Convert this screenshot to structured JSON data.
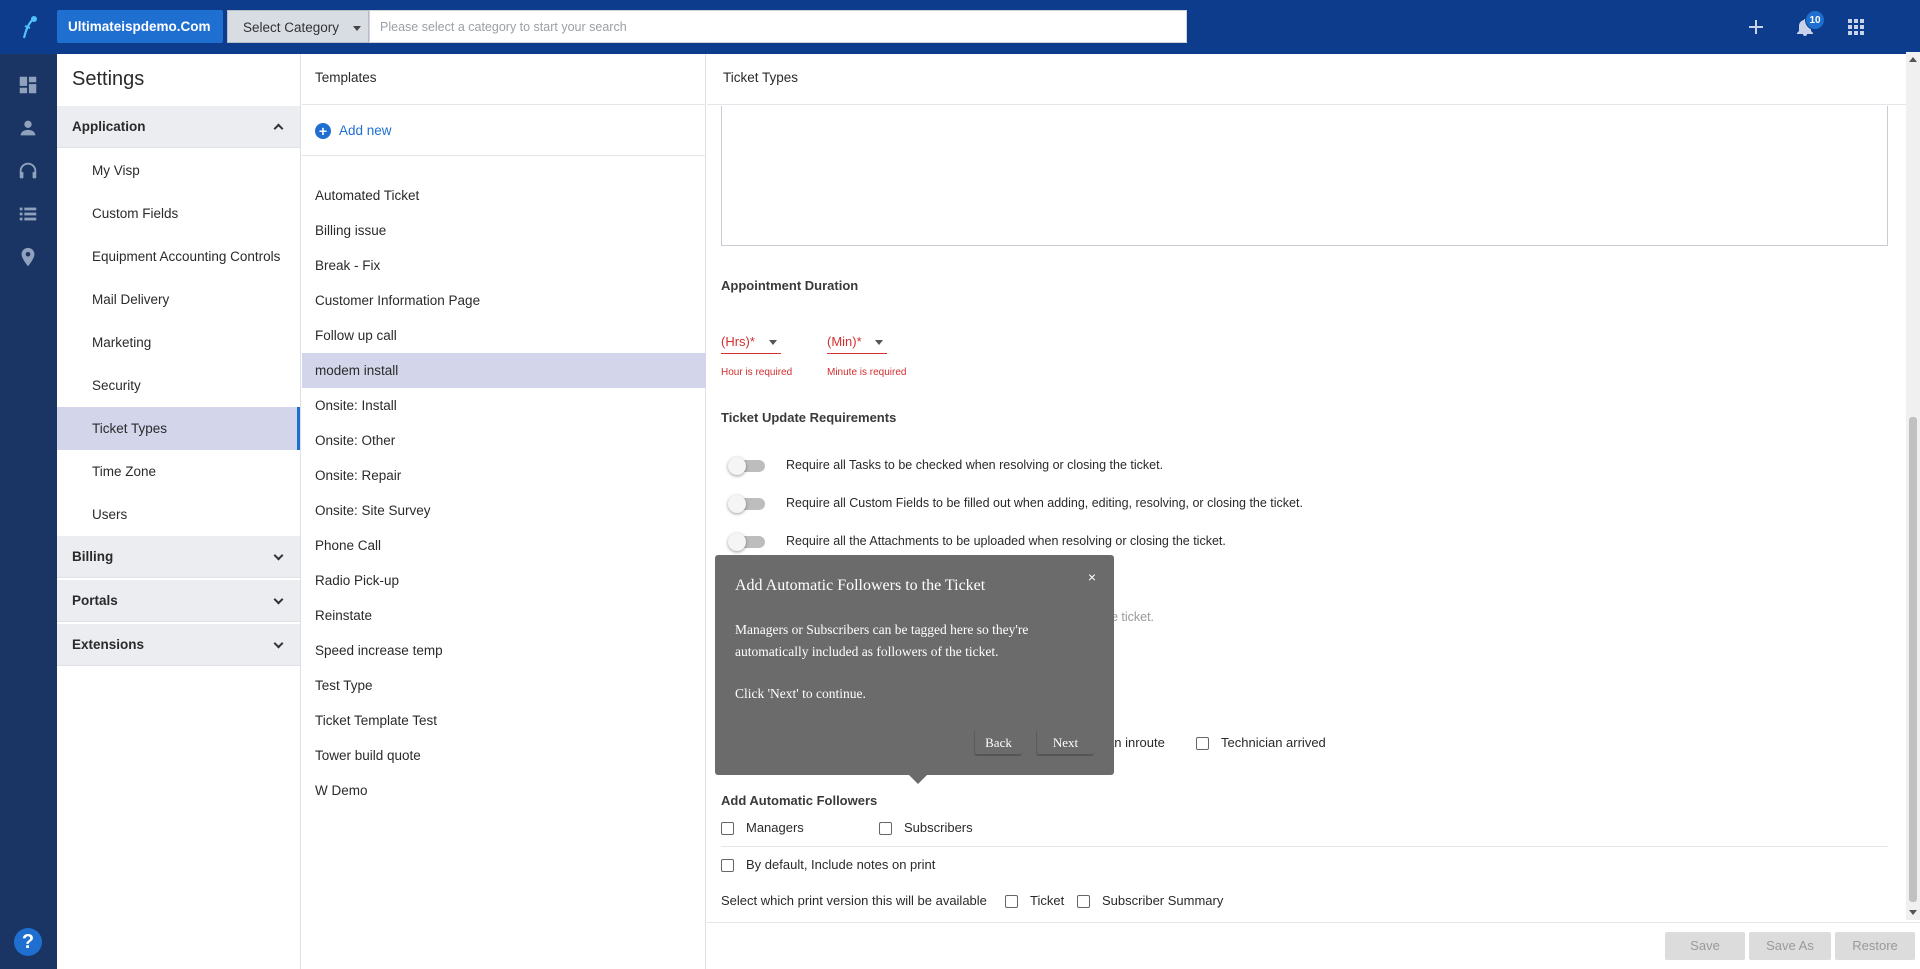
{
  "header": {
    "brand": "Ultimateispdemo.Com",
    "category": "Select Category",
    "search_placeholder": "Please select a category to start your search",
    "notification_count": "10"
  },
  "settings": {
    "title": "Settings",
    "sections": [
      {
        "label": "Application",
        "expanded": true
      },
      {
        "label": "Billing",
        "expanded": false
      },
      {
        "label": "Portals",
        "expanded": false
      },
      {
        "label": "Extensions",
        "expanded": false
      }
    ],
    "application_items": [
      "My Visp",
      "Custom Fields",
      "Equipment Accounting Controls",
      "Mail Delivery",
      "Marketing",
      "Security",
      "Ticket Types",
      "Time Zone",
      "Users"
    ],
    "active_item": "Ticket Types"
  },
  "templates": {
    "title": "Templates",
    "add_new": "Add new",
    "items": [
      "Automated Ticket",
      "Billing issue",
      "Break - Fix",
      "Customer Information Page",
      "Follow up call",
      "modem install",
      "Onsite: Install",
      "Onsite: Other",
      "Onsite: Repair",
      "Onsite: Site Survey",
      "Phone Call",
      "Radio Pick-up",
      "Reinstate",
      "Speed increase temp",
      "Test Type",
      "Ticket Template Test",
      "Tower build quote",
      "W Demo"
    ],
    "active_item": "modem install"
  },
  "ticket_types": {
    "title": "Ticket Types",
    "appointment_duration": {
      "label": "Appointment Duration",
      "hours_placeholder": "(Hrs)*",
      "minutes_placeholder": "(Min)*",
      "hours_error": "Hour is required",
      "minutes_error": "Minute is required"
    },
    "update_requirements": {
      "label": "Ticket Update Requirements",
      "toggles": [
        "Require all Tasks to be checked when resolving or closing the ticket.",
        "Require all Custom Fields to be filled out when adding, editing, resolving, or closing the ticket.",
        "Require all the Attachments to be uploaded when resolving or closing the ticket."
      ],
      "partial_text_1": "he ticket.",
      "partial_text_2": "."
    },
    "status_checks": {
      "partial_label": "an inroute",
      "technician_arrived": "Technician arrived"
    },
    "followers": {
      "label": "Add Automatic Followers",
      "managers": "Managers",
      "subscribers": "Subscribers"
    },
    "include_notes": "By default, Include notes on print",
    "print_version_label": "Select which print version this will be available",
    "print_ticket": "Ticket",
    "print_subscriber_summary": "Subscriber Summary",
    "buttons": {
      "save": "Save",
      "save_as": "Save As",
      "restore": "Restore"
    }
  },
  "popover": {
    "title": "Add Automatic Followers to the Ticket",
    "body": "Managers or Subscribers can be tagged here so they're automatically included as followers of the ticket.",
    "cta": "Click 'Next' to continue.",
    "close": "×",
    "back": "Back",
    "next": "Next"
  },
  "icons": [
    "logo-icon",
    "plus-icon",
    "bell-icon",
    "apps-grid-icon",
    "dashboard-icon",
    "user-icon",
    "headset-icon",
    "list-icon",
    "location-pin-icon",
    "help-icon",
    "add-circle-icon"
  ],
  "colors": {
    "topbar": "#0d3c8c",
    "accent": "#1e6fd0",
    "rail": "#1a3563",
    "error": "#d32f2f",
    "selected": "#d3d5ea",
    "popover": "#6b6b6b"
  }
}
